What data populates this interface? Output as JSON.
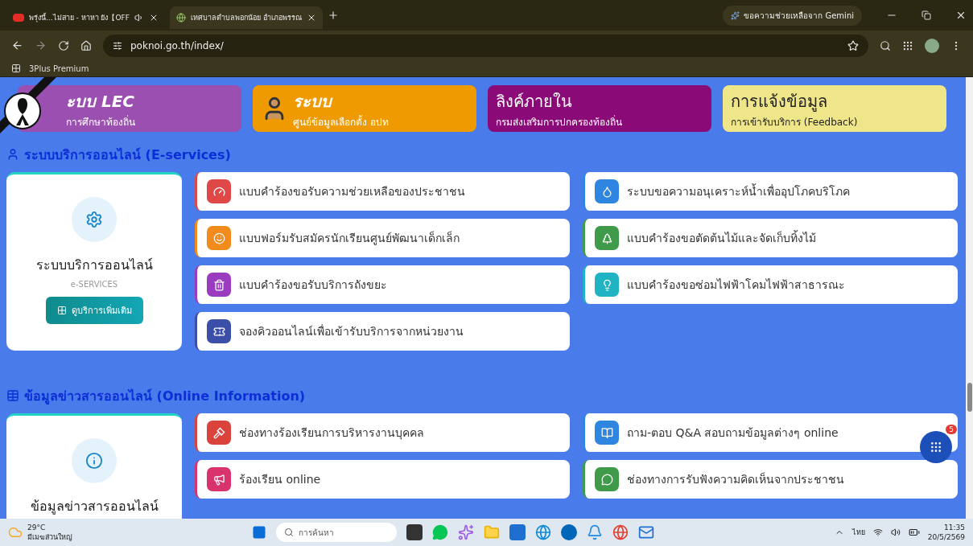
{
  "browser": {
    "tabs": [
      {
        "title": "พรุ่งนี้...ไม่สาย - หาหา ยัง【OFF",
        "kind": "video",
        "selected": false
      },
      {
        "title": "เทศบาลตำบลพอกน้อย อำเภอพรรณ",
        "kind": "site",
        "selected": true
      }
    ],
    "gemini": "ขอความช่วยเหลือจาก Gemini",
    "url": "poknoi.go.th/index/",
    "bookmarks": [
      "3Plus Premium"
    ]
  },
  "banners": [
    {
      "title": "ะบบ LEC",
      "subtitle": "การศึกษาท้องถิ่น",
      "color": "#9b4fb0",
      "kind": "italic"
    },
    {
      "title": "ระบบ",
      "subtitle": "ศูนย์ข้อมูลเลือกตั้ง อปท",
      "color": "#ee9a00",
      "kind": "person"
    },
    {
      "title": "ลิงค์ภายใน",
      "subtitle": "กรมส่งเสริมการปกครองท้องถิ่น",
      "color": "#8a0a78",
      "kind": "plain"
    },
    {
      "title": "การแจ้งข้อมูล",
      "subtitle": "การเข้ารับบริการ (Feedback)",
      "color": "#efe68a",
      "kind": "plain"
    }
  ],
  "sections": [
    {
      "title": "ระบบบริการออนไลน์ (E-services)",
      "card": {
        "title": "ระบบบริการออนไลน์",
        "subtitle": "e-SERVICES",
        "button": "ดูบริการเพิ่มเติม"
      },
      "services": [
        {
          "label": "แบบคำร้องขอรับความช่วยเหลือของประชาชน",
          "color": "#e04848"
        },
        {
          "label": "ระบบขอความอนุเคราะห์น้ำเพื่ออุปโภคบริโภค",
          "color": "#2f86e0"
        },
        {
          "label": "แบบฟอร์มรับสมัครนักเรียนศูนย์พัฒนาเด็กเล็ก",
          "color": "#f28a1c"
        },
        {
          "label": "แบบคำร้องขอตัดต้นไม้และจัดเก็บทิ้งไม้",
          "color": "#3f9b4a"
        },
        {
          "label": "แบบคำร้องขอรับบริการถังขยะ",
          "color": "#9b3bc0"
        },
        {
          "label": "แบบคำร้องขอซ่อมไฟฟ้าโคมไฟฟ้าสาธารณะ",
          "color": "#1fb3c4"
        },
        {
          "label": "จองคิวออนไลน์เพื่อเข้ารับบริการจากหน่วยงาน",
          "color": "#3b4fa8"
        }
      ]
    },
    {
      "title": "ข้อมูลข่าวสารออนไลน์ (Online Information)",
      "card": {
        "title": "ข้อมูลข่าวสารออนไลน์"
      },
      "services": [
        {
          "label": "ช่องทางร้องเรียนการบริหารงานบุคคล",
          "color": "#d9433c"
        },
        {
          "label": "ถาม-ตอบ Q&A สอบถามข้อมูลต่างๆ online",
          "color": "#2f86e0"
        },
        {
          "label": "ร้องเรียน online",
          "color": "#d8336e"
        },
        {
          "label": "ช่องทางการรับฟังความคิดเห็นจากประชาชน",
          "color": "#3f9b4a"
        }
      ]
    }
  ],
  "fab": {
    "badge": "5"
  },
  "taskbar": {
    "temp": "29°C",
    "weather": "มีเมฆส่วนใหญ่",
    "search": "การค้นหา",
    "lang": "ไทย",
    "time": "11:35",
    "date": "20/5/2569"
  }
}
